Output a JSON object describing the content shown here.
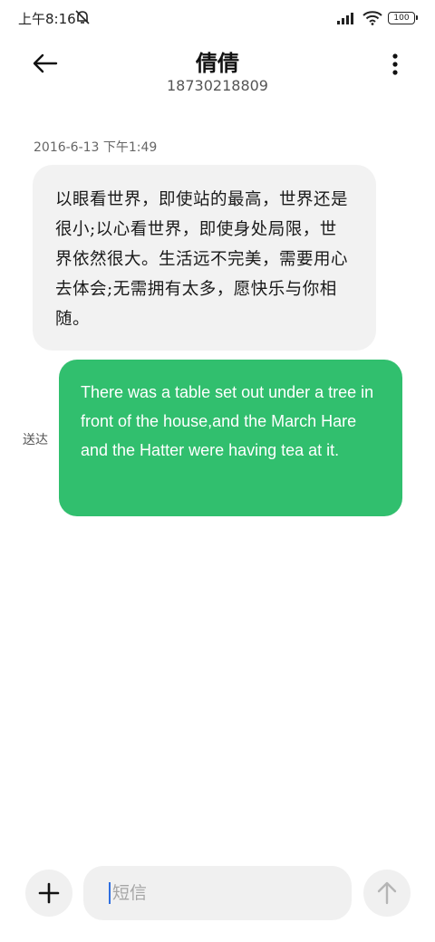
{
  "status_bar": {
    "time": "上午8:16",
    "battery": "100",
    "icons": [
      "mute-icon",
      "signal-icon",
      "wifi-icon",
      "battery-icon"
    ]
  },
  "header": {
    "contact_name": "倩倩",
    "contact_number": "18730218809",
    "icons": [
      "back-arrow-icon",
      "more-vertical-icon"
    ]
  },
  "conversation": {
    "timestamp": "2016-6-13 下午1:49",
    "incoming_message": "以眼看世界，即使站的最高，世界还是很小;以心看世界，即使身处局限，世界依然很大。生活远不完美，需要用心去体会;无需拥有太多，愿快乐与你相随。",
    "outgoing_message": "There was a table set out under a tree in front of the house,and the March Hare and the Hatter were having tea at it.",
    "delivered_label": "送达"
  },
  "composer": {
    "placeholder": "短信",
    "value": "",
    "icons": [
      "plus-icon",
      "send-arrow-icon"
    ]
  },
  "colors": {
    "outgoing_bubble": "#31bf6e",
    "incoming_bubble": "#f2f2f2",
    "cursor": "#2f6fe0"
  }
}
